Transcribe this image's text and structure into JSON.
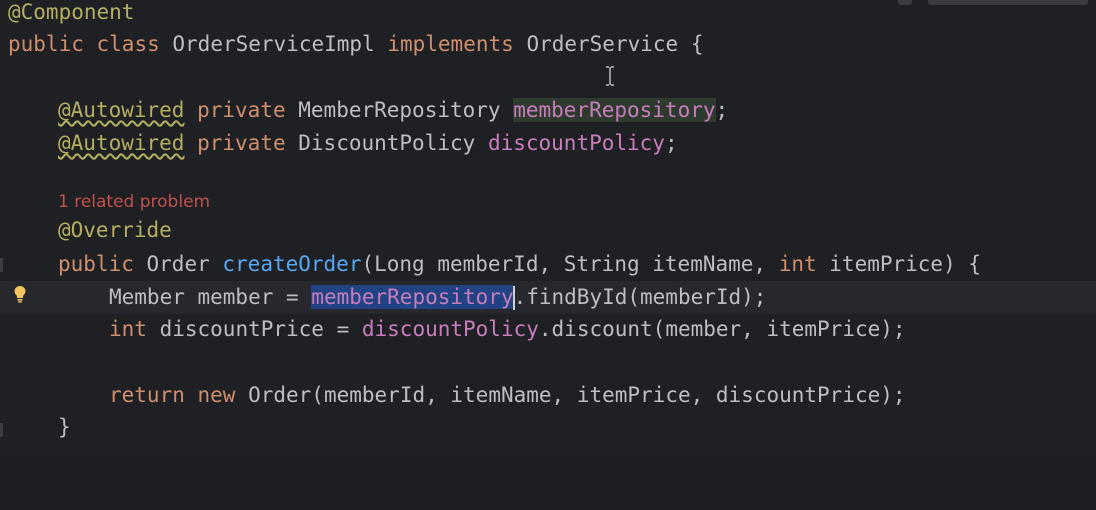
{
  "code": {
    "line_component": "@Component",
    "line_class": {
      "kw1": "public",
      "kw2": "class",
      "name": "OrderServiceImpl",
      "kw3": "implements",
      "iface": "OrderService",
      "brace": "{"
    },
    "field1": {
      "annotation": "@Autowired",
      "modifier": "private",
      "type": "MemberRepository",
      "name": "memberRepository",
      "end": ";"
    },
    "field2": {
      "annotation": "@Autowired",
      "modifier": "private",
      "type": "DiscountPolicy",
      "name": "discountPolicy",
      "end": ";"
    },
    "problem_hint": "1 related problem",
    "override": "@Override",
    "method_sig": {
      "kw": "public",
      "ret": "Order",
      "name": "createOrder",
      "params_1": "(Long memberId, String itemName, ",
      "kw_int": "int",
      "params_2": " itemPrice) {"
    },
    "stmt1": {
      "pre": "Member member = ",
      "field": "memberRepository",
      "post": ".findById(memberId);"
    },
    "stmt2": {
      "kw": "int",
      "pre": " discountPrice = ",
      "field": "discountPolicy",
      "post": ".discount(member, itemPrice);"
    },
    "stmt3": {
      "kw1": "return",
      "kw2": "new",
      "post": " Order(memberId, itemName, itemPrice, discountPrice);"
    },
    "close_brace": "}"
  },
  "colors": {
    "background": "#1f2023",
    "keyword": "#cf8e6d",
    "annotation": "#b3ae60",
    "field": "#c77dbb",
    "method": "#56a8f5",
    "text": "#bcbec4",
    "selection": "#214283",
    "error": "#c2504c"
  },
  "icons": {
    "gutter": "lightbulb-icon",
    "cursor": "text-cursor-icon"
  }
}
